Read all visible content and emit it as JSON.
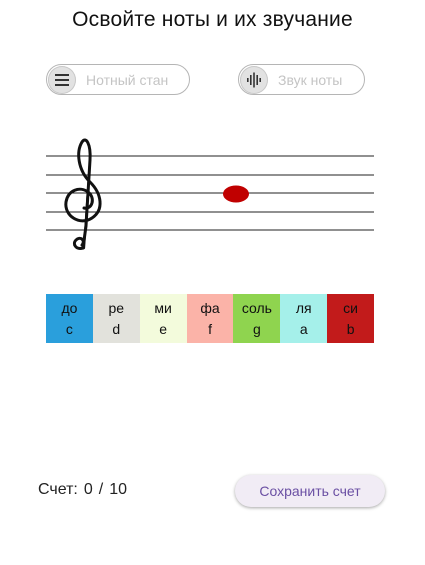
{
  "title": "Освойте ноты и их звучание",
  "toggles": {
    "staff": {
      "label": "Нотный стан",
      "icon": "menu-lines-icon"
    },
    "sound": {
      "label": "Звук ноты",
      "icon": "sound-wave-icon"
    }
  },
  "staff": {
    "clef": "𝄞",
    "note_color": "#c00000"
  },
  "notes": [
    {
      "ru": "до",
      "en": "c",
      "color": "#2a9fdc"
    },
    {
      "ru": "ре",
      "en": "d",
      "color": "#e2e2dc"
    },
    {
      "ru": "ми",
      "en": "e",
      "color": "#f3fbdc"
    },
    {
      "ru": "фа",
      "en": "f",
      "color": "#fbb3a8"
    },
    {
      "ru": "соль",
      "en": "g",
      "color": "#8fd44f"
    },
    {
      "ru": "ля",
      "en": "a",
      "color": "#a5f0ea"
    },
    {
      "ru": "си",
      "en": "b",
      "color": "#c21b1b"
    }
  ],
  "score": {
    "label": "Счет:",
    "current": "0",
    "separator": "/",
    "total": "10"
  },
  "save_button": {
    "label": "Сохранить счет"
  }
}
